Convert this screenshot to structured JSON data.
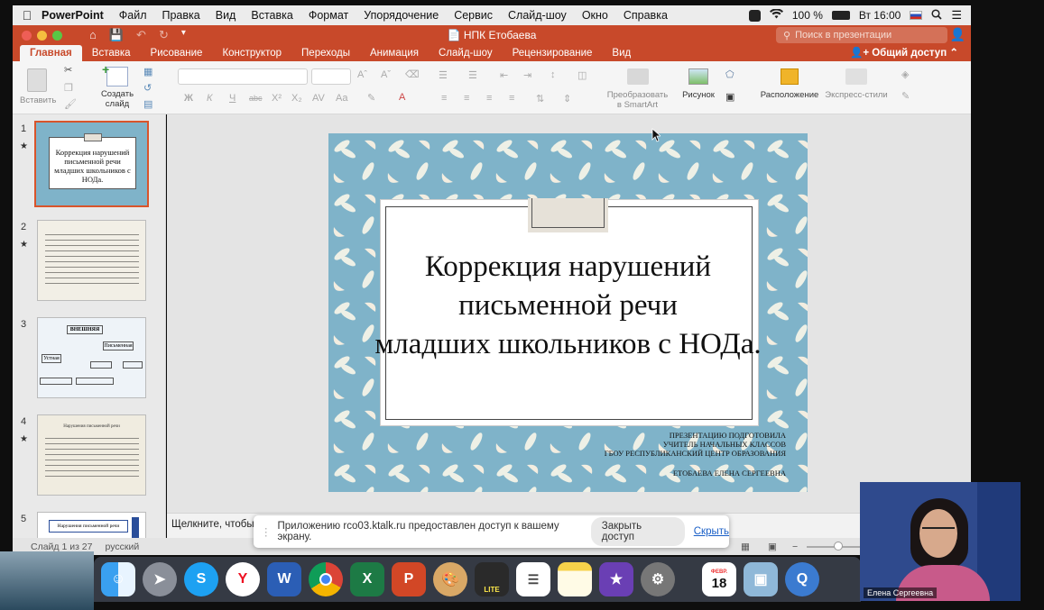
{
  "menubar": {
    "app": "PowerPoint",
    "items": [
      "Файл",
      "Правка",
      "Вид",
      "Вставка",
      "Формат",
      "Упорядочение",
      "Сервис",
      "Слайд-шоу",
      "Окно",
      "Справка"
    ],
    "battery": "100 %",
    "clock": "Вт 16:00"
  },
  "window": {
    "title": "НПК Етобаева",
    "search_placeholder": "Поиск в презентации"
  },
  "tabs": [
    "Главная",
    "Вставка",
    "Рисование",
    "Конструктор",
    "Переходы",
    "Анимация",
    "Слайд-шоу",
    "Рецензирование",
    "Вид"
  ],
  "share_label": "Общий доступ",
  "ribbon": {
    "paste": "Вставить",
    "new_slide_1": "Создать",
    "new_slide_2": "слайд",
    "smartart_1": "Преобразовать",
    "smartart_2": "в SmartArt",
    "picture": "Рисунок",
    "arrange": "Расположение",
    "quick_styles": "Экспресс-стили"
  },
  "thumbnails": [
    {
      "num": "1",
      "star": "★",
      "title": "Коррекция нарушений письменной речи младших школьников с НОДа."
    },
    {
      "num": "2",
      "star": "★"
    },
    {
      "num": "3",
      "star": "",
      "label_top": "ВНЕШНЯЯ",
      "label_right": "Письменная",
      "label_left": "Устная"
    },
    {
      "num": "4",
      "star": "★",
      "title": "Нарушения письменной речи"
    },
    {
      "num": "5",
      "star": "",
      "title": "Нарушения письменной речи"
    }
  ],
  "slide": {
    "title_line1": "Коррекция нарушений",
    "title_line2": "письменной речи",
    "title_line3": "младших школьников с НОДа.",
    "credit1": "ПРЕЗЕНТАЦИЮ ПОДГОТОВИЛА",
    "credit2": "УЧИТЕЛЬ НАЧАЛЬНЫХ КЛАССОВ",
    "credit3": "ГБОУ РЕСПУБЛИКАНСКИЙ ЦЕНТР ОБРАЗОВАНИЯ",
    "credit4": "ЕТОБАЕВА ЕЛЕНА СЕРГЕЕВНА"
  },
  "notes_placeholder": "Щелкните, чтобы д",
  "status": {
    "slide": "Слайд 1 из 27",
    "lang": "русский"
  },
  "banner": {
    "text": "Приложению rco03.ktalk.ru предоставлен доступ к вашему экрану.",
    "stop": "Закрыть доступ",
    "hide": "Скрыть"
  },
  "dock_date": {
    "month": "ФЕВР.",
    "day": "18"
  },
  "webcam": {
    "name": "Елена Сергеевна"
  }
}
